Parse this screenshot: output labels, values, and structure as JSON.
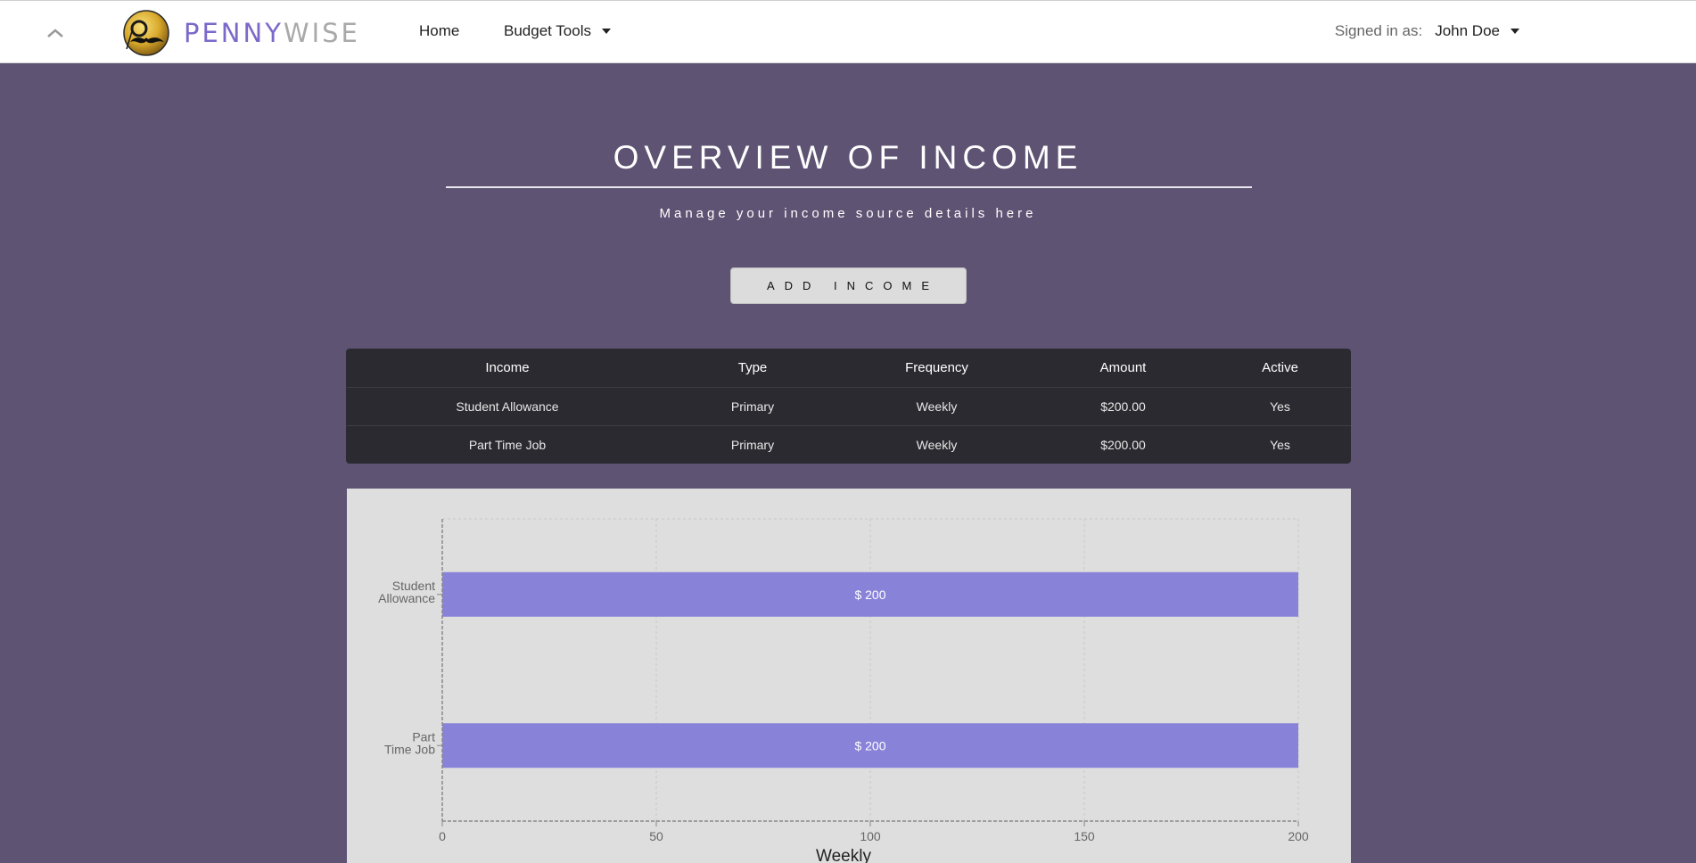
{
  "navbar": {
    "brand": {
      "part1": "PENNY",
      "part2": "WISE"
    },
    "links": {
      "home": "Home",
      "budget_tools": "Budget Tools"
    },
    "signed_in_label": "Signed in as:",
    "user_name": "John Doe"
  },
  "page": {
    "title": "OVERVIEW OF INCOME",
    "subtitle": "Manage your income source details here",
    "add_button": "ADD INCOME"
  },
  "table": {
    "headers": [
      "Income",
      "Type",
      "Frequency",
      "Amount",
      "Active"
    ],
    "rows": [
      [
        "Student Allowance",
        "Primary",
        "Weekly",
        "$200.00",
        "Yes"
      ],
      [
        "Part Time Job",
        "Primary",
        "Weekly",
        "$200.00",
        "Yes"
      ]
    ]
  },
  "colors": {
    "background": "#5e5373",
    "bar": "#8883d8",
    "brand_accent": "#7b68c9"
  },
  "icons": {
    "collapse": "chevron-up-icon",
    "dropdown": "caret-down-icon",
    "logo": "monocle-mustache-logo"
  },
  "chart_data": {
    "type": "bar",
    "orientation": "horizontal",
    "categories": [
      [
        "Student",
        "Allowance"
      ],
      [
        "Part",
        "Time Job"
      ]
    ],
    "values": [
      200,
      200
    ],
    "data_labels": [
      "$ 200",
      "$ 200"
    ],
    "xlabel": "Weekly",
    "xlim": [
      0,
      200
    ],
    "xticks": [
      0,
      50,
      100,
      150,
      200
    ],
    "grid": true,
    "bar_color": "#8883d8"
  }
}
